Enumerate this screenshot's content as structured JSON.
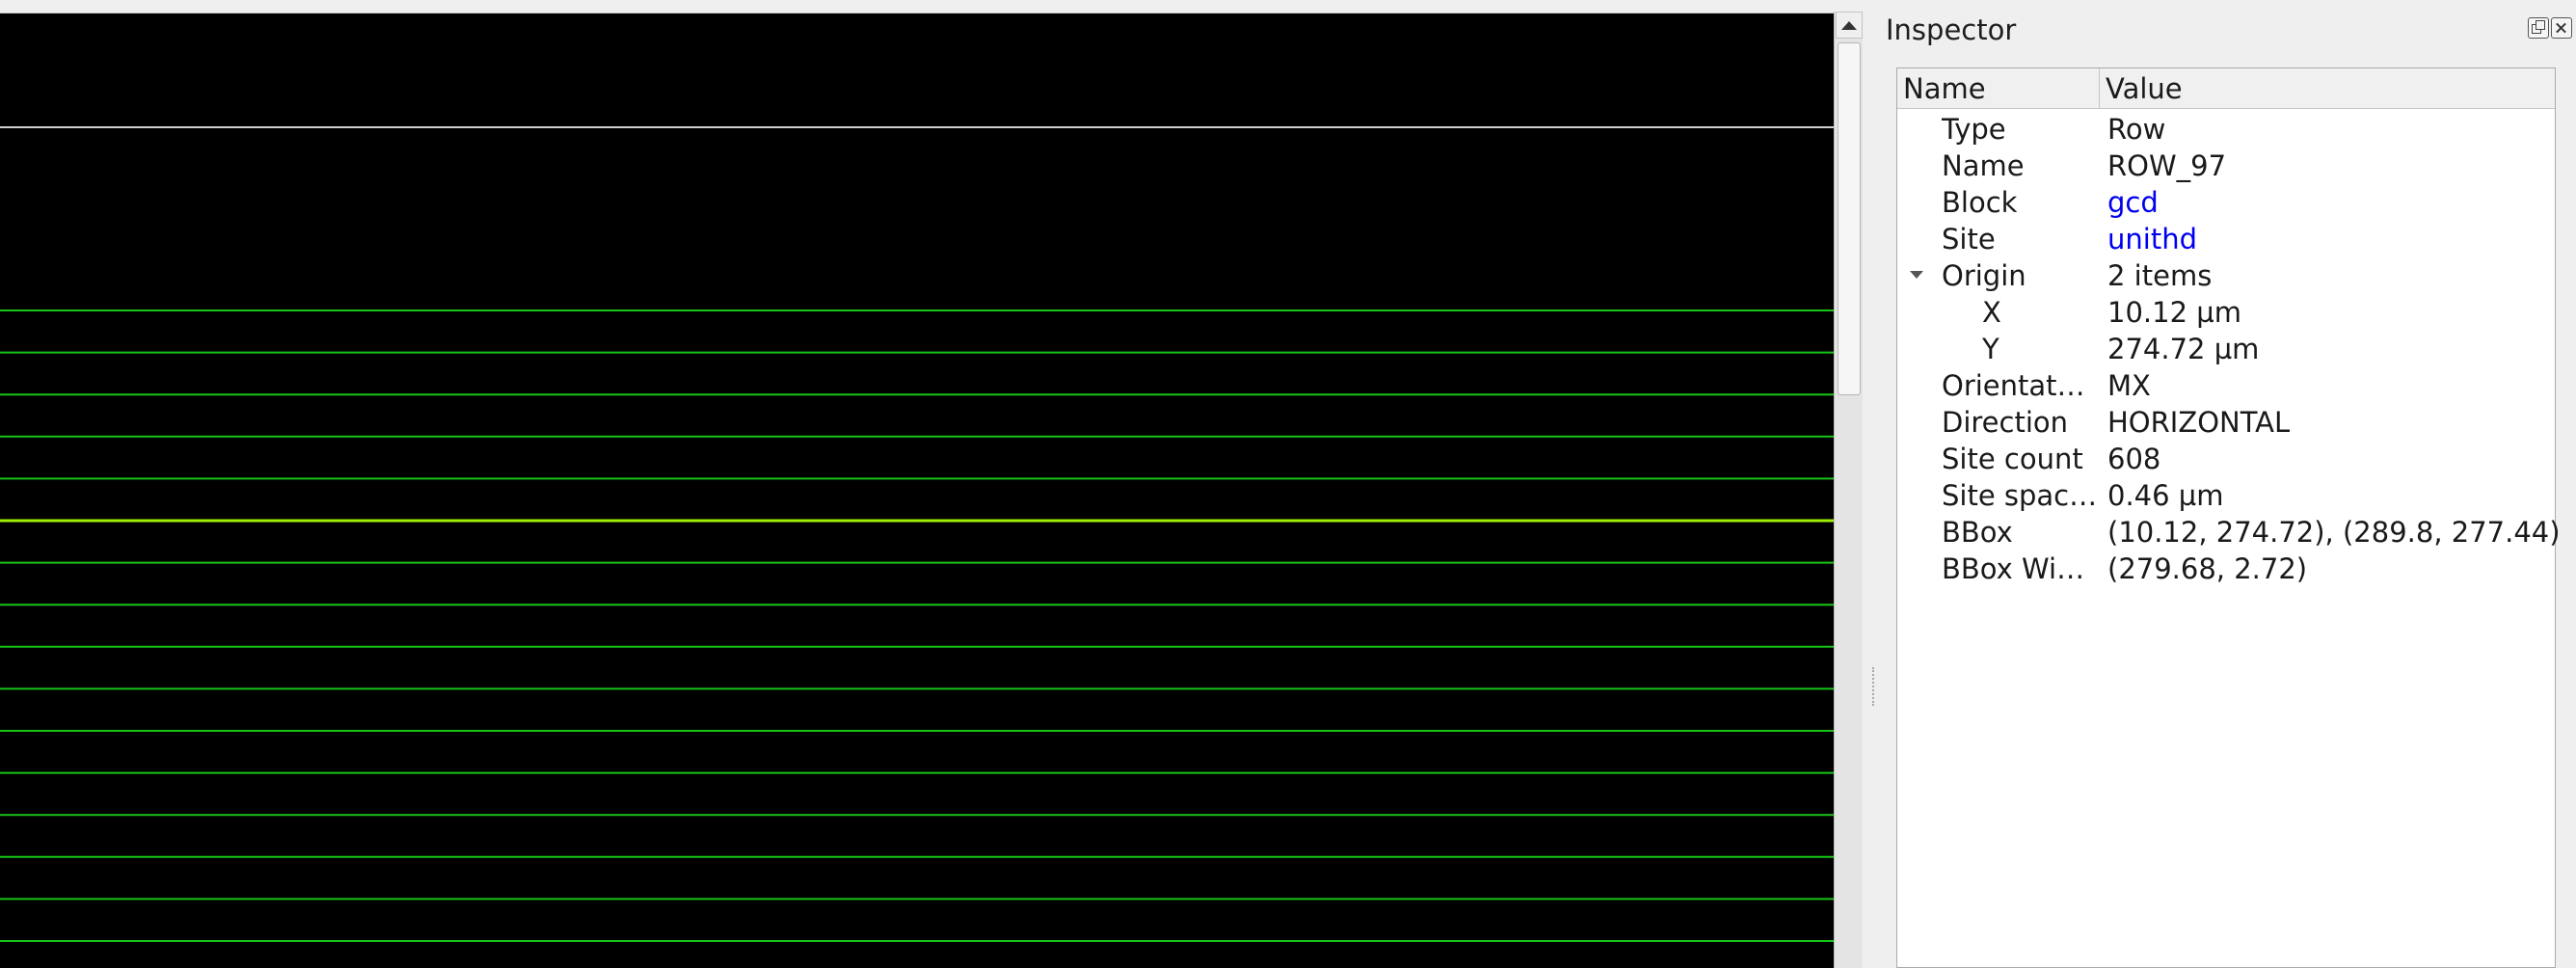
{
  "inspector": {
    "title": "Inspector",
    "columns": {
      "name": "Name",
      "value": "Value"
    },
    "rows": [
      {
        "name": "Type",
        "value": "Row",
        "link": false
      },
      {
        "name": "Name",
        "value": "ROW_97",
        "link": false
      },
      {
        "name": "Block",
        "value": "gcd",
        "link": true
      },
      {
        "name": "Site",
        "value": "unithd",
        "link": true
      },
      {
        "name": "Origin",
        "value": "2 items",
        "link": false,
        "expanded": true
      },
      {
        "name": "X",
        "value": "10.12 µm",
        "link": false,
        "child": true
      },
      {
        "name": "Y",
        "value": "274.72 µm",
        "link": false,
        "child": true
      },
      {
        "name": "Orientat…",
        "value": "MX",
        "link": false
      },
      {
        "name": "Direction",
        "value": "HORIZONTAL",
        "link": false
      },
      {
        "name": "Site count",
        "value": "608",
        "link": false
      },
      {
        "name": "Site spac…",
        "value": "0.46 µm",
        "link": false
      },
      {
        "name": "BBox",
        "value": "(10.12, 274.72), (289.8, 277.44)",
        "link": false
      },
      {
        "name": "BBox Wi…",
        "value": "(279.68, 2.72)",
        "link": false
      }
    ],
    "icons": {
      "float": "float-icon",
      "close": "close-icon"
    }
  },
  "canvas": {
    "background": "#000000",
    "boundary_color": "#cfcfcf",
    "row_color": "#18c418",
    "selected_row_color": "#9ef000",
    "row_line_count": 16,
    "selected_row_index": 5
  },
  "colors": {
    "link": "#0000ee"
  }
}
